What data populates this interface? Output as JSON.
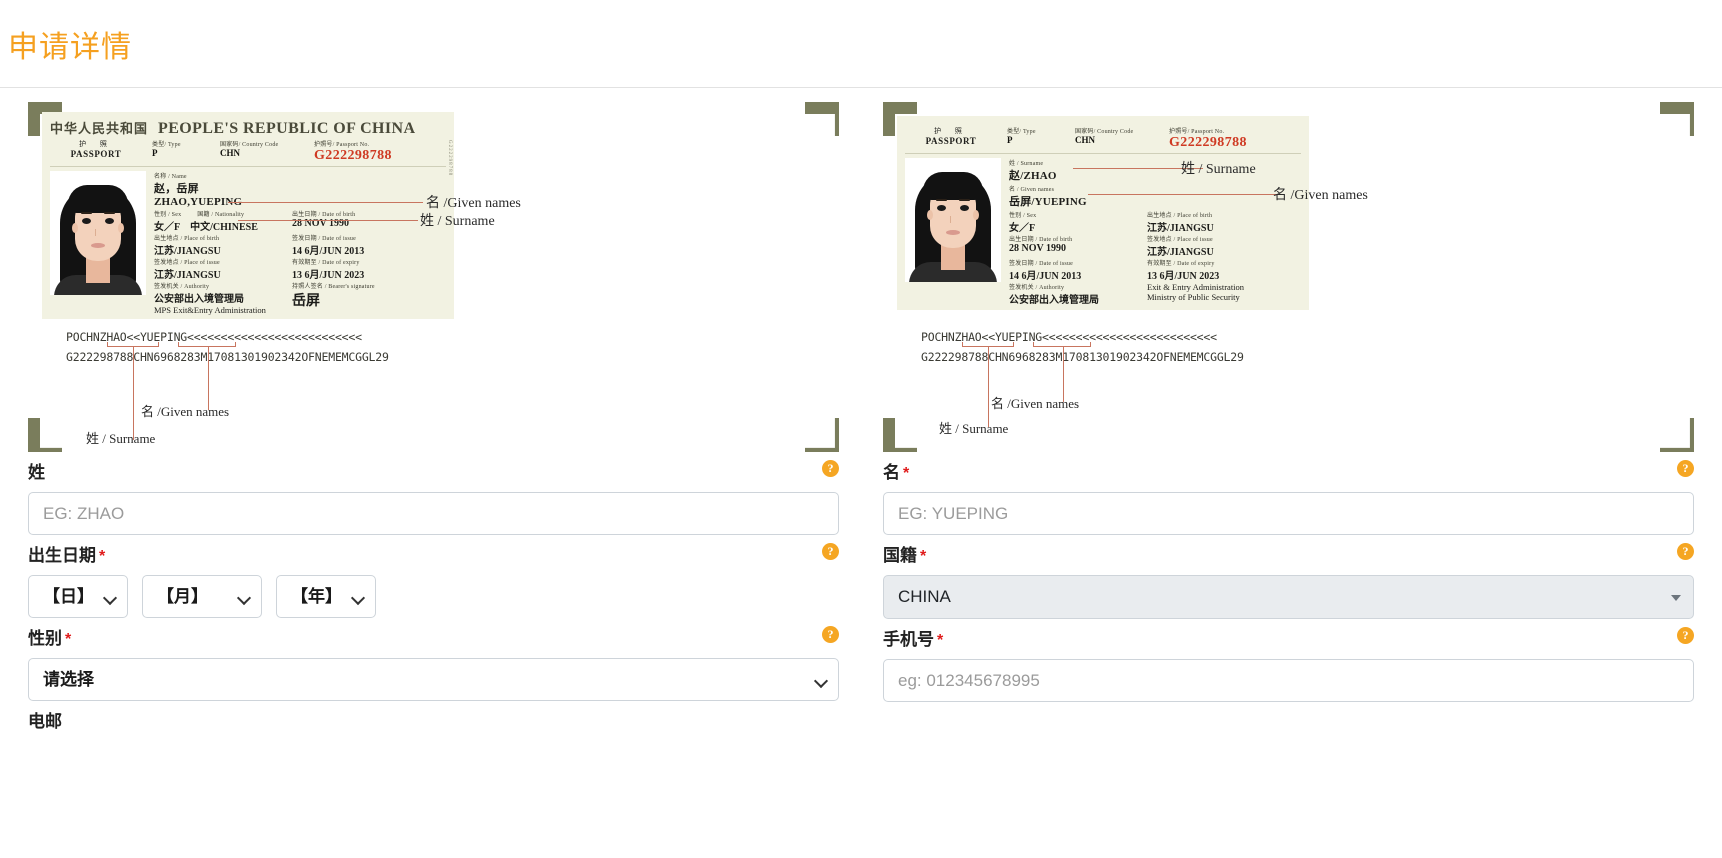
{
  "header": {
    "title": "申请详情"
  },
  "passport": {
    "country_cn": "中华人民共和国",
    "country_en": "PEOPLE'S REPUBLIC OF CHINA",
    "passport_word_cn": "护 照",
    "passport_word_en": "PASSPORT",
    "type_label": "类型/ Type",
    "type_value": "P",
    "country_code_label": "国家码/ Country Code",
    "country_code_value": "CHN",
    "passport_no_label": "护照号/ Passport No.",
    "passport_no_value": "G222298788",
    "name_label": "名称 / Name",
    "name_cn": "赵，岳屏",
    "name_en": "ZHAO,YUEPING",
    "surname_label": "姓 / Surname",
    "surname_value": "赵/ZHAO",
    "given_label": "名 / Given names",
    "given_value": "岳屏/YUEPING",
    "sex_label": "性别 / Sex",
    "sex_value": "女／F",
    "nationality_label": "国籍 / Nationality",
    "nationality_value": "中文/CHINESE",
    "dob_label": "出生日期 / Date of birth",
    "dob_value": "28 NOV 1990",
    "pob_label": "出生地点 / Place of birth",
    "pob_value": "江苏/JIANGSU",
    "doi_label": "签发日期 / Date of issue",
    "doi_value": "14 6月/JUN 2013",
    "poi_label": "签发地点 / Place of issue",
    "poi_value": "江苏/JIANGSU",
    "expiry_label": "有效期至 / Date of expiry",
    "expiry_value": "13 6月/JUN 2023",
    "authority_label": "签发机关 / Authority",
    "authority_cn": "公安部出入境管理局",
    "authority_en": "MPS Exit&Entry Administration",
    "authority_en_r1": "Exit & Entry Administration",
    "authority_en_r2": "Ministry of Public Security",
    "signature_label": "持照人签名 / Bearer's signature",
    "signature_value": "岳屏",
    "mrz_line1": "POCHNZHAO<<YUEPING<<<<<<<<<<<<<<<<<<<<<<<<<<",
    "mrz_line2": "G222298788CHN6968283M17081301902342OFNEMEMCGGL29",
    "side_text": "G222298788"
  },
  "annotations": {
    "given_names": "名 /Given names",
    "surname": "姓 / Surname"
  },
  "form": {
    "surname": {
      "label": "姓",
      "required": false,
      "placeholder": "EG: ZHAO",
      "value": "",
      "help": "?"
    },
    "given_name": {
      "label": "名",
      "required": true,
      "placeholder": "EG: YUEPING",
      "value": "",
      "help": "?"
    },
    "dob": {
      "label": "出生日期",
      "required": true,
      "help": "?",
      "day": "【日】",
      "month": "【月】",
      "year": "【年】"
    },
    "nationality": {
      "label": "国籍",
      "required": true,
      "help": "?",
      "value": "CHINA"
    },
    "gender": {
      "label": "性别",
      "required": true,
      "help": "?",
      "value": "请选择"
    },
    "phone": {
      "label": "手机号",
      "required": true,
      "help": "?",
      "placeholder": "eg: 012345678995",
      "value": ""
    },
    "email": {
      "label": "电邮",
      "required": false,
      "placeholder": "",
      "value": ""
    }
  },
  "colors": {
    "accent": "#f5a020",
    "required": "#e01b1b",
    "help_badge": "#f5a623",
    "passport_number": "#cf3a23",
    "passport_bg": "#f2f2e2",
    "corner_bracket": "#7a7d5c"
  }
}
